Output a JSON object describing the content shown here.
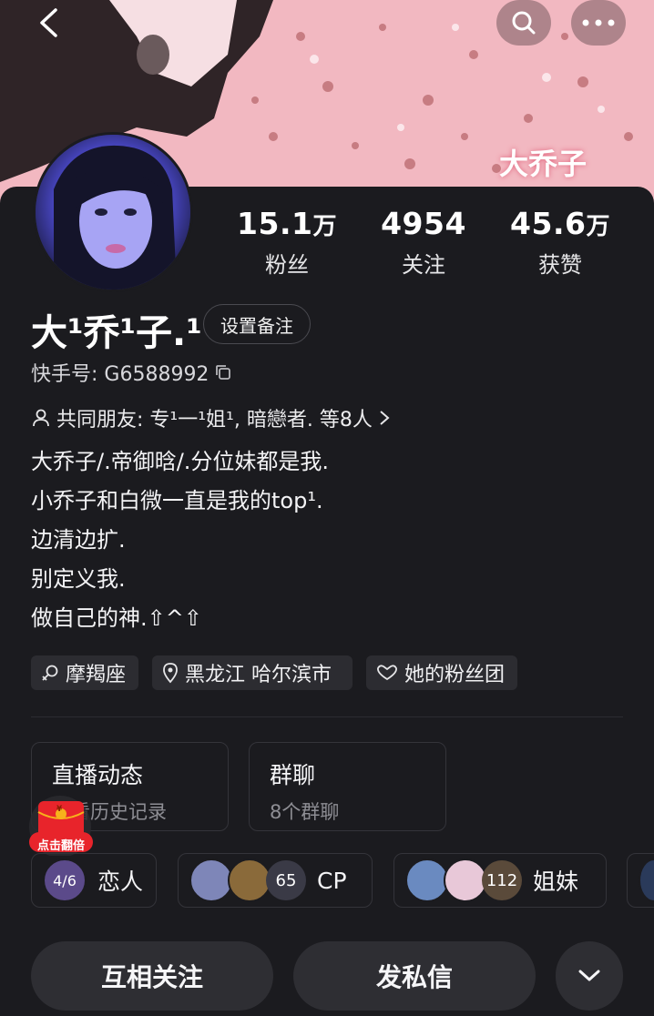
{
  "profile": {
    "banner_watermark": "大乔子",
    "name": "大¹乔¹子.¹",
    "remark_button": "设置备注",
    "kuaishou_id": "快手号: G6588992",
    "mutual_friends": "共同朋友: 专¹一¹姐¹, 暗戀者. 等8人",
    "bio": [
      "大乔子/.帝御晗/.分位妹都是我.",
      "小乔子和白微一直是我的top¹.",
      "边清边扩.",
      "别定义我.",
      "做自己的神.⇧^⇧"
    ]
  },
  "stats": [
    {
      "value": "15.1",
      "unit": "万",
      "label": "粉丝"
    },
    {
      "value": "4954",
      "unit": "",
      "label": "关注"
    },
    {
      "value": "45.6",
      "unit": "万",
      "label": "获赞"
    }
  ],
  "tags": {
    "zodiac": "摩羯座",
    "location": "黑龙江 哈尔滨市",
    "fan_club": "她的粉丝团"
  },
  "cards": {
    "live": {
      "title": "直播动态",
      "subtitle": "查看历史记录"
    },
    "group": {
      "title": "群聊",
      "subtitle": "8个群聊"
    }
  },
  "relations": {
    "lovers": {
      "count": "4/6",
      "label": "恋人"
    },
    "cp": {
      "count": "65",
      "label": "CP"
    },
    "sisters": {
      "count": "112",
      "label": "姐妹"
    }
  },
  "red_packet": {
    "label": "点击翻倍",
    "symbol": "¥"
  },
  "actions": {
    "follow": "互相关注",
    "message": "发私信"
  },
  "colors": {
    "background": "#1b1b1f",
    "banner": "#f2b8c1",
    "chip": "#2c2c31",
    "red_packet": "#e8242b"
  }
}
